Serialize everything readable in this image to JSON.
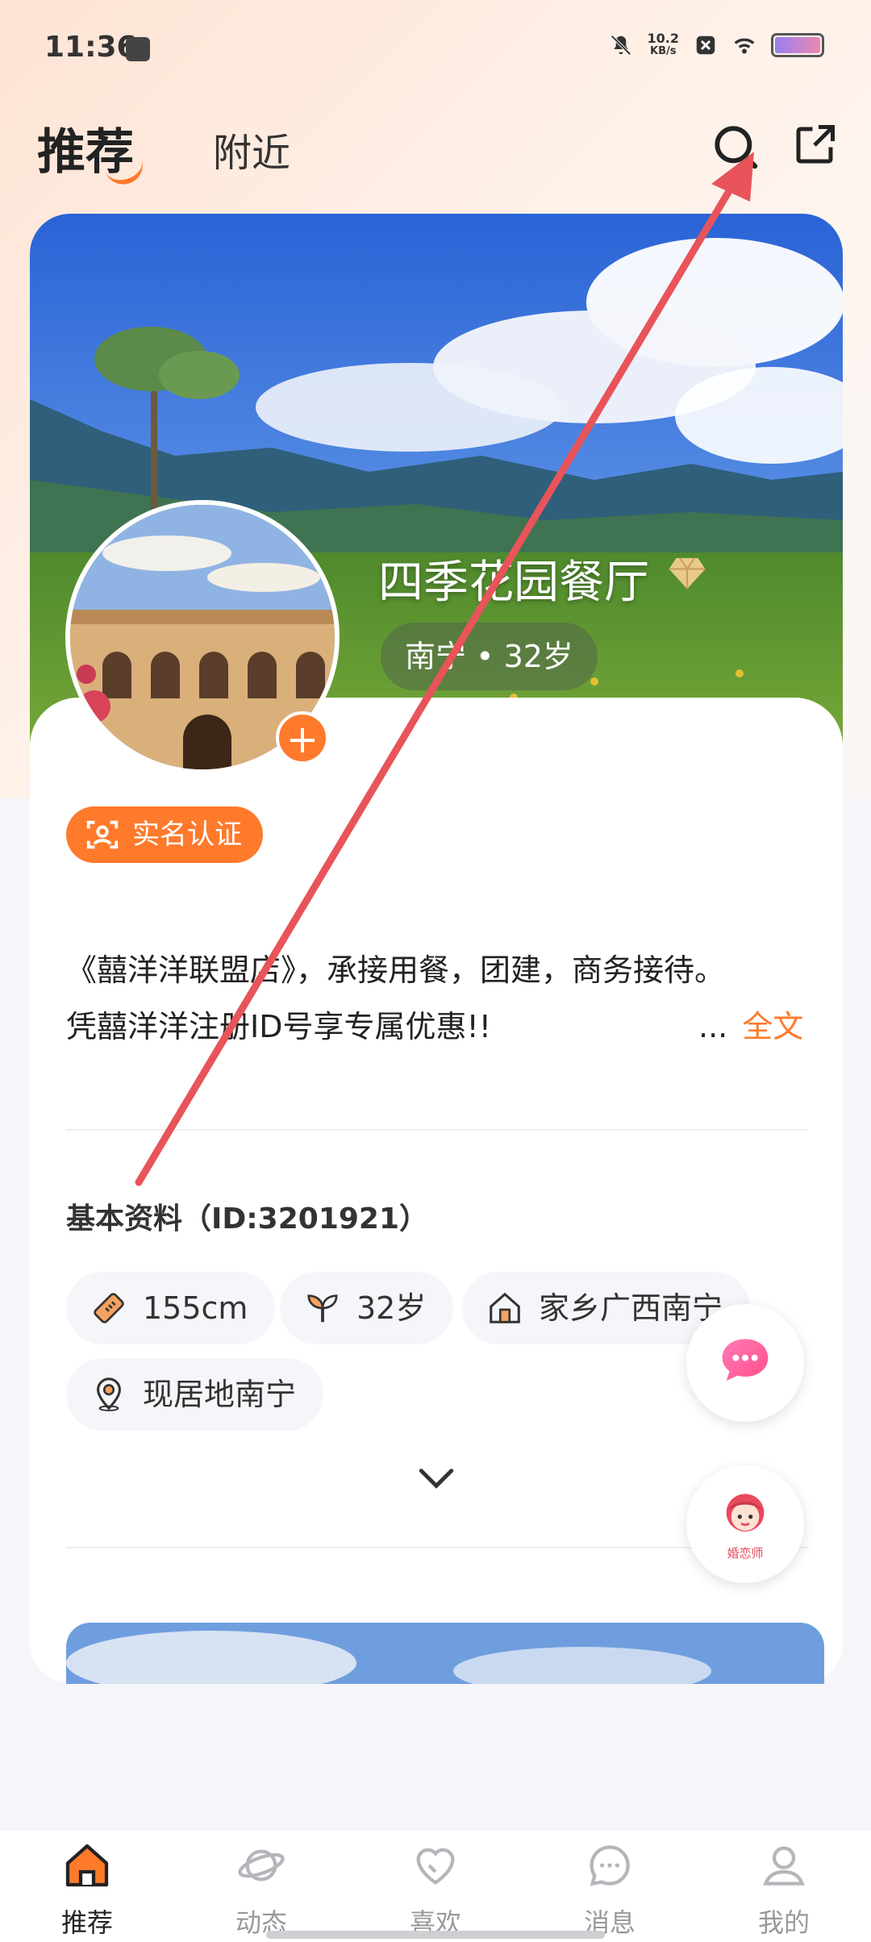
{
  "status_bar": {
    "time": "11:36",
    "net_speed_value": "10.2",
    "net_speed_unit": "KB/s"
  },
  "header": {
    "tabs": [
      {
        "label": "推荐",
        "active": true
      },
      {
        "label": "附近",
        "active": false
      }
    ],
    "icons": [
      "search-icon",
      "share-icon"
    ]
  },
  "profile": {
    "name": "四季花园餐厅",
    "location_age": "南宁 • 32岁",
    "verify_label": "实名认证",
    "bio_line1": "《囍洋洋联盟店》，承接用餐，团建，商务接待。",
    "bio_line2": "凭囍洋洋注册ID号享专属优惠!!",
    "bio_ellipsis": "...",
    "bio_full_link": "全文",
    "basic_info_title": "基本资料（ID:3201921）",
    "chips": [
      {
        "icon": "ruler-icon",
        "label": "155cm"
      },
      {
        "icon": "sprout-icon",
        "label": "32岁"
      },
      {
        "icon": "house-icon",
        "label": "家乡广西南宁"
      },
      {
        "icon": "location-pin-icon",
        "label": "现居地南宁"
      }
    ]
  },
  "fabs": {
    "chat_icon": "chat-bubble-icon",
    "matchmaker_label": "婚恋师"
  },
  "bottom_nav": [
    {
      "label": "推荐",
      "icon": "home-icon",
      "active": true
    },
    {
      "label": "动态",
      "icon": "planet-icon",
      "active": false
    },
    {
      "label": "喜欢",
      "icon": "heart-icon",
      "active": false
    },
    {
      "label": "消息",
      "icon": "message-icon",
      "active": false
    },
    {
      "label": "我的",
      "icon": "person-icon",
      "active": false
    }
  ],
  "colors": {
    "accent": "#ff7a2b",
    "annotation_arrow": "#e8545a",
    "page_bg": "#f6f6fa"
  }
}
